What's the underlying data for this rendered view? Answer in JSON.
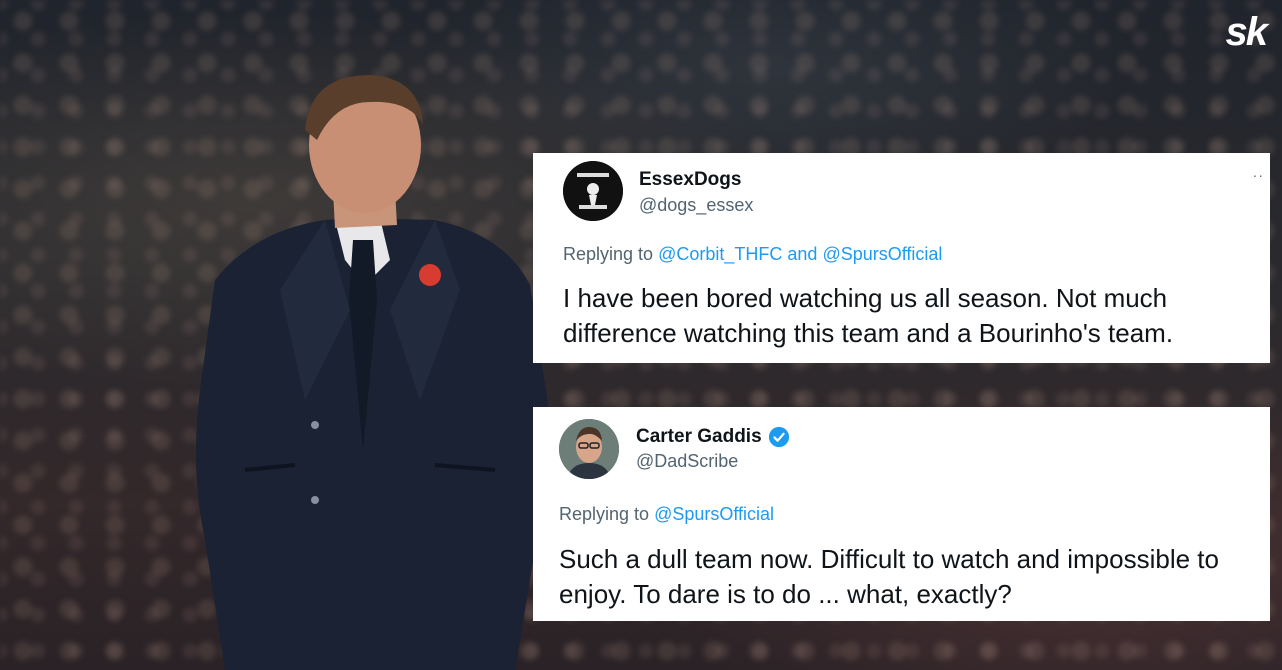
{
  "brand": {
    "logo_text": "sk"
  },
  "tweets": [
    {
      "name": "EssexDogs",
      "handle": "@dogs_essex",
      "verified": false,
      "replying_prefix": "Replying to",
      "replying_to_1": "@Corbit_THFC",
      "replying_joiner": "and",
      "replying_to_2": "@SpursOfficial",
      "text": "I have been bored watching us all season. Not much difference watching this team and a Bourinho's team.",
      "more": "··"
    },
    {
      "name": "Carter Gaddis",
      "handle": "@DadScribe",
      "verified": true,
      "replying_prefix": "Replying to",
      "replying_to_1": "@SpursOfficial",
      "text": "Such a dull team now. Difficult to watch and impossible to enjoy. To dare is to do ... what, exactly?"
    }
  ],
  "colors": {
    "link": "#1d9bf0",
    "muted": "#536471",
    "text": "#0f1419",
    "card": "#ffffff"
  }
}
